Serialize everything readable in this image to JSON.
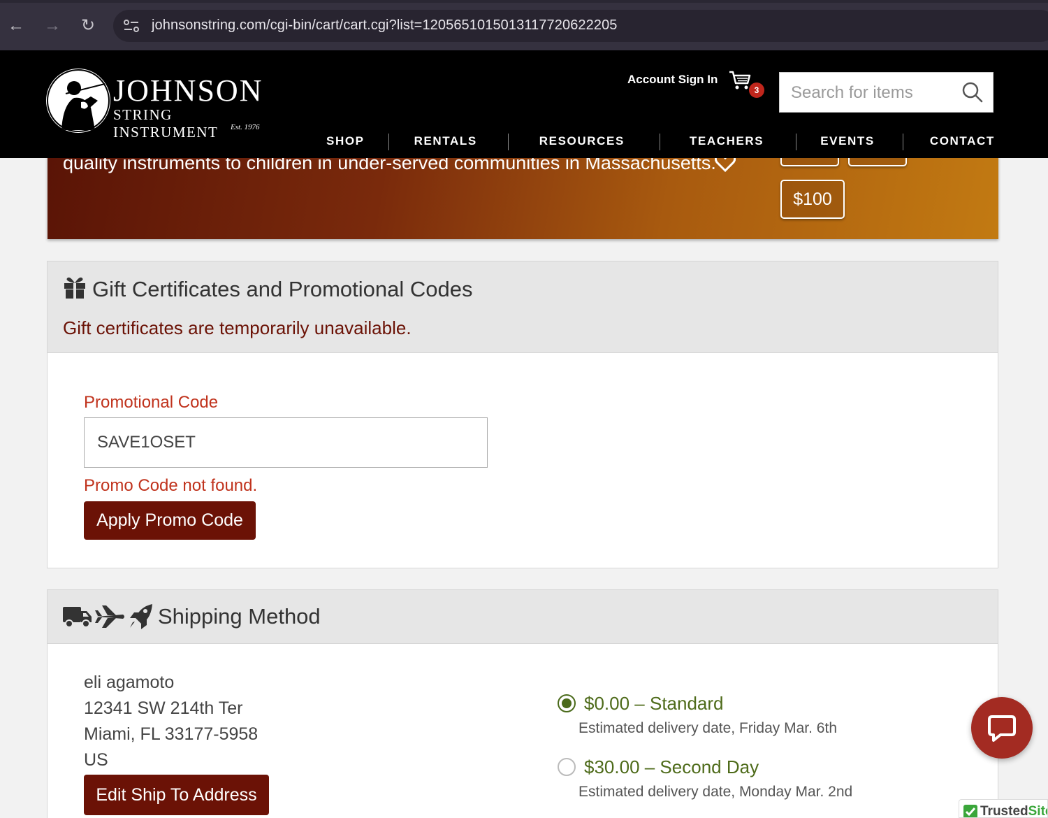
{
  "browser": {
    "url": "johnsonstring.com/cgi-bin/cart/cart.cgi?list=1205651015013117720622205"
  },
  "header": {
    "logo_title": "JOHNSON",
    "logo_subtitle": "STRING INSTRUMENT",
    "logo_est": "Est. 1976",
    "account_link": "Account Sign In",
    "cart_count": "3",
    "search_placeholder": "Search for items",
    "nav": [
      "SHOP",
      "RENTALS",
      "RESOURCES",
      "TEACHERS",
      "EVENTS",
      "CONTACT"
    ]
  },
  "banner": {
    "text": "quality instruments to children in under-served communities in Massachusetts.",
    "donate_100": "$100"
  },
  "gift": {
    "title": "Gift Certificates and Promotional Codes",
    "unavailable": "Gift certificates are temporarily unavailable.",
    "promo_label": "Promotional Code",
    "promo_value": "SAVE1OSET",
    "promo_error": "Promo Code not found.",
    "apply_label": "Apply Promo Code"
  },
  "shipping": {
    "title": "Shipping Method",
    "address": [
      "eli agamoto",
      "12341 SW 214th Ter",
      "Miami, FL 33177-5958",
      "US"
    ],
    "edit_label": "Edit Ship To Address",
    "options": [
      {
        "title": "$0.00 – Standard",
        "desc": "Estimated delivery date, Friday Mar. 6th",
        "selected": true
      },
      {
        "title": "$30.00 – Second Day",
        "desc": "Estimated delivery date, Monday Mar. 2nd",
        "selected": false
      }
    ]
  },
  "trusted": {
    "part1": "Trusted",
    "part2": "Site"
  }
}
